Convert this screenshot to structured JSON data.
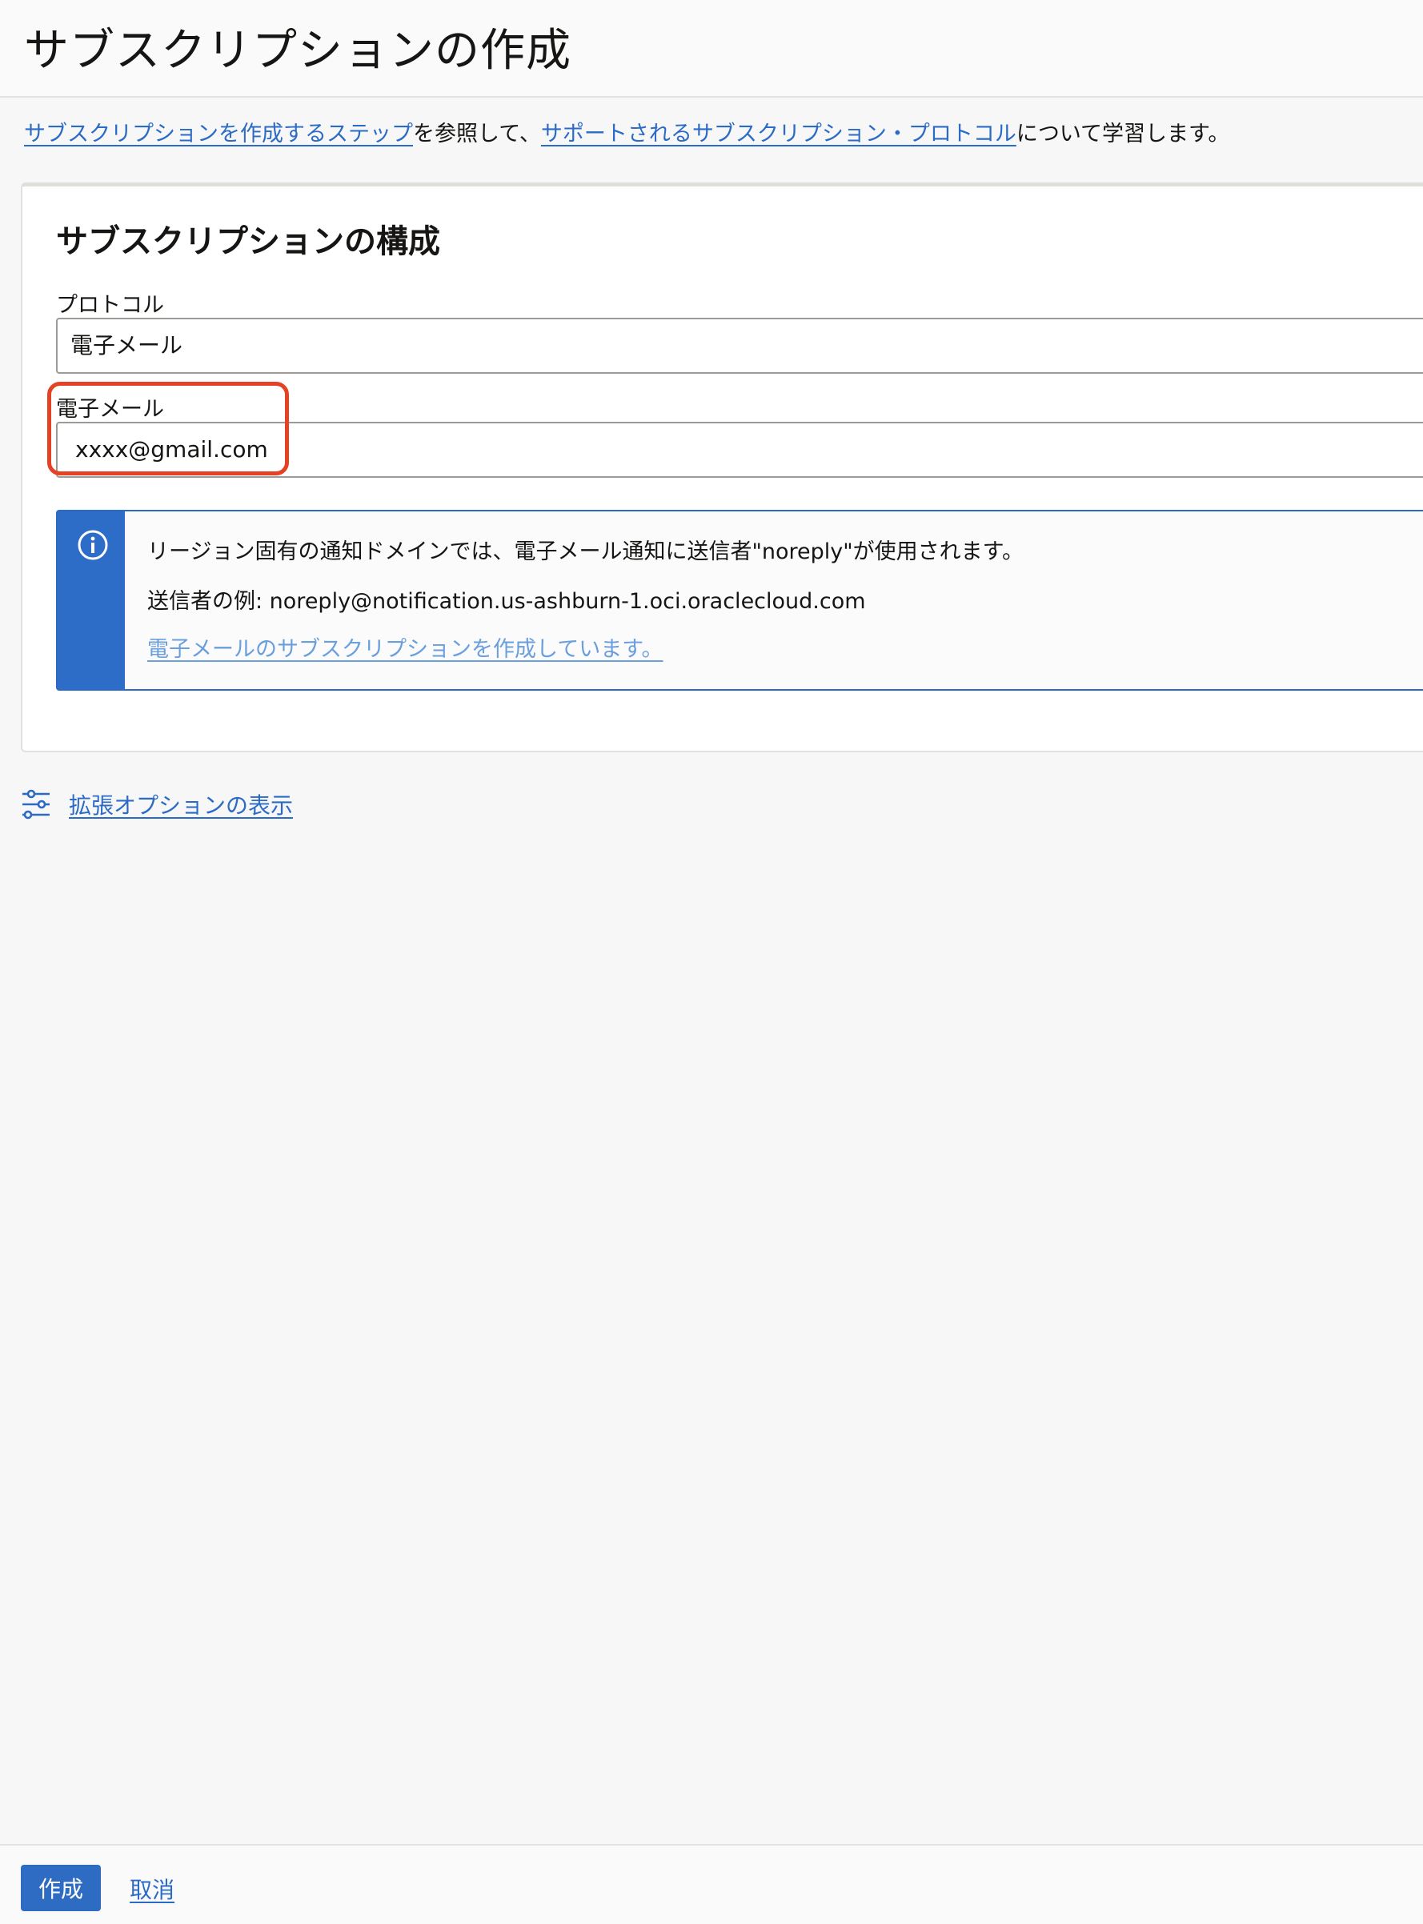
{
  "header": {
    "title": "サブスクリプションの作成"
  },
  "intro": {
    "link1": "サブスクリプションを作成するステップ",
    "text1": "を参照して、",
    "link2": "サポートされるサブスクリプション・プロトコル",
    "text2": "について学習します。"
  },
  "card": {
    "title": "サブスクリプションの構成",
    "protocol_label": "プロトコル",
    "protocol_value": "電子メール",
    "email_label": "電子メール",
    "email_value": "xxxx@gmail.com"
  },
  "info": {
    "line1": "リージョン固有の通知ドメインでは、電子メール通知に送信者\"noreply\"が使用されます。",
    "line2": "送信者の例: noreply@notification.us-ashburn-1.oci.oraclecloud.com",
    "link": "電子メールのサブスクリプションを作成しています。"
  },
  "advanced": {
    "label": "拡張オプションの表示",
    "icon": "sliders-icon"
  },
  "footer": {
    "create_label": "作成",
    "cancel_label": "取消"
  },
  "colors": {
    "accent": "#2e6bc3",
    "link": "#2b6bc6",
    "highlight": "#e54125"
  }
}
